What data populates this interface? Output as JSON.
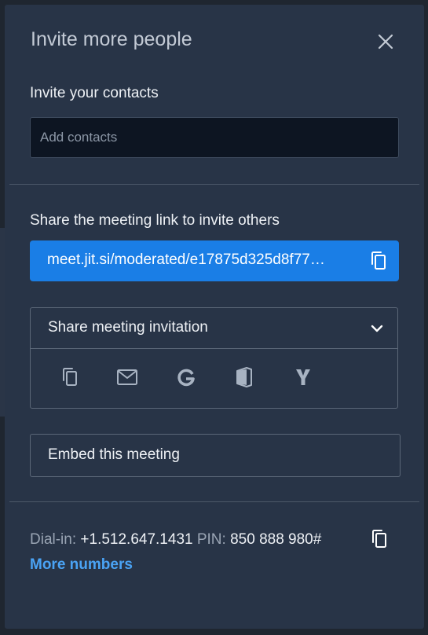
{
  "dialog": {
    "title": "Invite more people",
    "contacts_label": "Invite your contacts",
    "contacts_placeholder": "Add contacts",
    "link_label": "Share the meeting link to invite others",
    "meeting_link": "meet.jit.si/moderated/e17875d325d8f77d…",
    "share": {
      "header_label": "Share meeting invitation",
      "icons": [
        "copy-icon",
        "email-icon",
        "google-icon",
        "outlook-icon",
        "yahoo-icon"
      ]
    },
    "embed_label": "Embed this meeting",
    "dialin": {
      "label": "Dial-in:",
      "number": "+1.512.647.1431",
      "pin_label": "PIN:",
      "pin": "850 888 980#",
      "more_numbers": "More numbers"
    }
  },
  "colors": {
    "background": "#1f2630",
    "dialog": "#283447",
    "accent": "#1a7ee6",
    "link": "#4aa3f5"
  }
}
